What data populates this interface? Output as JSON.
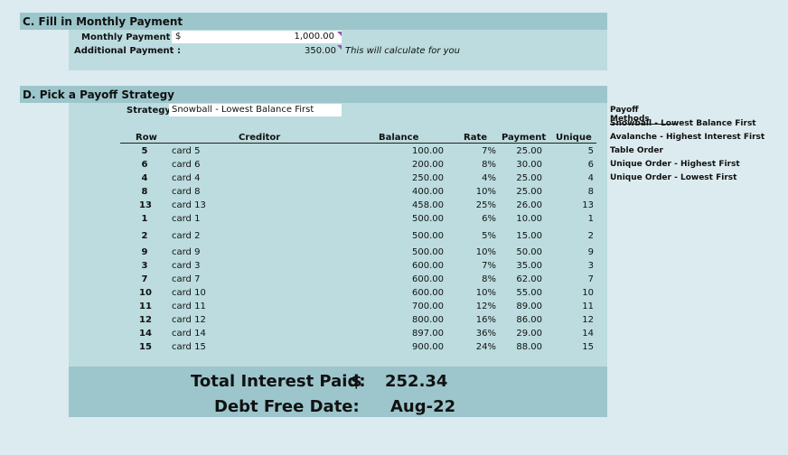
{
  "section_c": {
    "title": "C. Fill in Monthly Payment",
    "monthly_payment_label": "Monthly Payment :",
    "monthly_payment_currency": "$",
    "monthly_payment_value": "1,000.00",
    "additional_payment_label": "Additional Payment :",
    "additional_payment_value": "350.00",
    "additional_payment_note": "This will calculate for you"
  },
  "section_d": {
    "title": "D. Pick a Payoff Strategy",
    "strategy_label": "Strategy:",
    "strategy_value": "Snowball - Lowest Balance First",
    "columns": {
      "row": "Row",
      "creditor": "Creditor",
      "balance": "Balance",
      "rate": "Rate",
      "payment": "Payment",
      "unique": "Unique"
    },
    "rows": [
      {
        "row": "5",
        "creditor": "card 5",
        "balance": "100.00",
        "rate": "7%",
        "payment": "25.00",
        "unique": "5"
      },
      {
        "row": "6",
        "creditor": "card 6",
        "balance": "200.00",
        "rate": "8%",
        "payment": "30.00",
        "unique": "6"
      },
      {
        "row": "4",
        "creditor": "card 4",
        "balance": "250.00",
        "rate": "4%",
        "payment": "25.00",
        "unique": "4"
      },
      {
        "row": "8",
        "creditor": "card 8",
        "balance": "400.00",
        "rate": "10%",
        "payment": "25.00",
        "unique": "8"
      },
      {
        "row": "13",
        "creditor": "card 13",
        "balance": "458.00",
        "rate": "25%",
        "payment": "26.00",
        "unique": "13"
      },
      {
        "row": "1",
        "creditor": "card 1",
        "balance": "500.00",
        "rate": "6%",
        "payment": "10.00",
        "unique": "1"
      },
      {
        "row": "2",
        "creditor": "card 2",
        "balance": "500.00",
        "rate": "5%",
        "payment": "15.00",
        "unique": "2"
      },
      {
        "row": "9",
        "creditor": "card 9",
        "balance": "500.00",
        "rate": "10%",
        "payment": "50.00",
        "unique": "9"
      },
      {
        "row": "3",
        "creditor": "card 3",
        "balance": "600.00",
        "rate": "7%",
        "payment": "35.00",
        "unique": "3"
      },
      {
        "row": "7",
        "creditor": "card 7",
        "balance": "600.00",
        "rate": "8%",
        "payment": "62.00",
        "unique": "7"
      },
      {
        "row": "10",
        "creditor": "card 10",
        "balance": "600.00",
        "rate": "10%",
        "payment": "55.00",
        "unique": "10"
      },
      {
        "row": "11",
        "creditor": "card 11",
        "balance": "700.00",
        "rate": "12%",
        "payment": "89.00",
        "unique": "11"
      },
      {
        "row": "12",
        "creditor": "card 12",
        "balance": "800.00",
        "rate": "16%",
        "payment": "86.00",
        "unique": "12"
      },
      {
        "row": "14",
        "creditor": "card 14",
        "balance": "897.00",
        "rate": "36%",
        "payment": "29.00",
        "unique": "14"
      },
      {
        "row": "15",
        "creditor": "card 15",
        "balance": "900.00",
        "rate": "24%",
        "payment": "88.00",
        "unique": "15"
      }
    ],
    "total_interest_label": "Total Interest Paid:",
    "total_interest_currency": "$",
    "total_interest_value": "252.34",
    "debt_free_label": "Debt Free Date:",
    "debt_free_value": "Aug-22"
  },
  "payoff_methods": {
    "title": "Payoff Methods",
    "items": [
      "Snowball - Lowest Balance First",
      "Avalanche - Highest Interest First",
      "Table Order",
      "Unique Order - Highest First",
      "Unique Order - Lowest First"
    ]
  }
}
